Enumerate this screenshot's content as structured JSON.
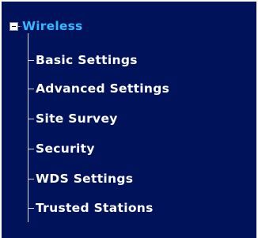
{
  "menu": {
    "root": {
      "label": "Wireless",
      "expanded": true,
      "toggle_icon": "collapse-minus-icon"
    },
    "items": [
      {
        "label": "Basic Settings"
      },
      {
        "label": "Advanced Settings"
      },
      {
        "label": "Site Survey"
      },
      {
        "label": "Security"
      },
      {
        "label": "WDS Settings"
      },
      {
        "label": "Trusted Stations"
      }
    ]
  },
  "colors": {
    "background": "#00135a",
    "root_label": "#36b8ff",
    "item_label": "#ffffff",
    "tree_lines": "#d8d8d8"
  }
}
